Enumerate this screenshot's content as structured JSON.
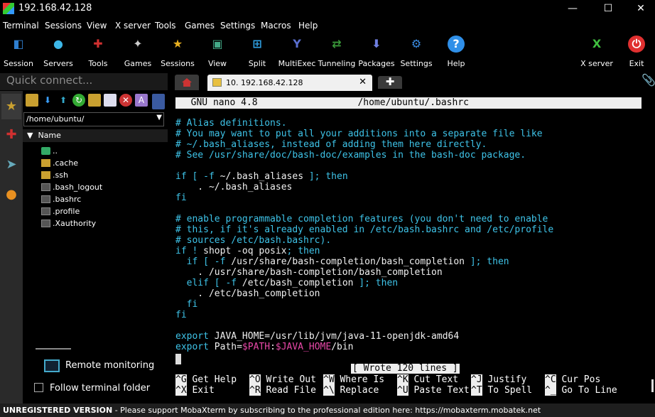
{
  "window": {
    "title": "192.168.42.128",
    "minimize": "—",
    "maximize": "☐",
    "close": "✕"
  },
  "menu": [
    "Terminal",
    "Sessions",
    "View",
    "X server",
    "Tools",
    "Games",
    "Settings",
    "Macros",
    "Help"
  ],
  "toolbar": [
    {
      "label": "Session",
      "icon": "session-icon",
      "glyph": "◧",
      "color": "#2f7fd0"
    },
    {
      "label": "Servers",
      "icon": "servers-icon",
      "glyph": "●",
      "color": "#3db7e8"
    },
    {
      "label": "Tools",
      "icon": "tools-icon",
      "glyph": "✚",
      "color": "#d03030"
    },
    {
      "label": "Games",
      "icon": "games-icon",
      "glyph": "✦",
      "color": "#cccccc"
    },
    {
      "label": "Sessions",
      "icon": "star-icon",
      "glyph": "★",
      "color": "#e8b020"
    },
    {
      "label": "View",
      "icon": "view-icon",
      "glyph": "▣",
      "color": "#4a8"
    },
    {
      "label": "Split",
      "icon": "split-icon",
      "glyph": "⊞",
      "color": "#2f9fe0"
    },
    {
      "label": "MultiExec",
      "icon": "multiexec-icon",
      "glyph": "Y",
      "color": "#5a6fd0"
    },
    {
      "label": "Tunneling",
      "icon": "tunneling-icon",
      "glyph": "⇄",
      "color": "#3a9a3a"
    },
    {
      "label": "Packages",
      "icon": "packages-icon",
      "glyph": "⬇",
      "color": "#6f7fe0"
    },
    {
      "label": "Settings",
      "icon": "settings-icon",
      "glyph": "⚙",
      "color": "#3a8ae0"
    },
    {
      "label": "Help",
      "icon": "help-icon",
      "glyph": "?",
      "color": "#2f8fe8"
    },
    {
      "label": "X server",
      "icon": "xserver-icon",
      "glyph": "X",
      "color": "#40c040"
    },
    {
      "label": "Exit",
      "icon": "exit-icon",
      "glyph": "⏻",
      "color": "#e03030"
    }
  ],
  "quick_connect": {
    "placeholder": "Quick connect..."
  },
  "tabs": {
    "session_label": "10. 192.168.42.128",
    "close": "✕",
    "add": "✚"
  },
  "files": {
    "path": "/home/ubuntu/",
    "column": "Name",
    "items": [
      {
        "name": "..",
        "type": "up"
      },
      {
        "name": ".cache",
        "type": "folder"
      },
      {
        "name": ".ssh",
        "type": "folder"
      },
      {
        "name": ".bash_logout",
        "type": "file"
      },
      {
        "name": ".bashrc",
        "type": "file"
      },
      {
        "name": ".profile",
        "type": "file"
      },
      {
        "name": ".Xauthority",
        "type": "file"
      }
    ],
    "remote_monitoring": "Remote monitoring",
    "follow_folder": "Follow terminal folder"
  },
  "nano": {
    "header": "  GNU nano 4.8                  /home/ubuntu/.bashrc",
    "status": "[ Wrote 120 lines ]",
    "shortcuts_row1": [
      {
        "key": "^G",
        "label": " Get Help  "
      },
      {
        "key": "^O",
        "label": " Write Out "
      },
      {
        "key": "^W",
        "label": " Where Is  "
      },
      {
        "key": "^K",
        "label": " Cut Text  "
      },
      {
        "key": "^J",
        "label": " Justify   "
      },
      {
        "key": "^C",
        "label": " Cur Pos"
      }
    ],
    "shortcuts_row2": [
      {
        "key": "^X",
        "label": " Exit      "
      },
      {
        "key": "^R",
        "label": " Read File "
      },
      {
        "key": "^\\",
        "label": " Replace   "
      },
      {
        "key": "^U",
        "label": " Paste Text"
      },
      {
        "key": "^T",
        "label": " To Spell  "
      },
      {
        "key": "^_",
        "label": " Go To Line"
      }
    ]
  },
  "bashrc": {
    "l1": "# Alias definitions.",
    "l2": "# You may want to put all your additions into a separate file like",
    "l3": "# ~/.bash_aliases, instead of adding them here directly.",
    "l4": "# See /usr/share/doc/bash-doc/examples in the bash-doc package.",
    "l6a": "if [ ",
    "l6b": "-f",
    "l6c": " ~/.bash_aliases",
    "l6d": " ]; then",
    "l7": "    . ~/.bash_aliases",
    "l8": "fi",
    "l10": "# enable programmable completion features (you don't need to enable",
    "l11": "# this, if it's already enabled in /etc/bash.bashrc and /etc/profile",
    "l12": "# sources /etc/bash.bashrc).",
    "l13a": "if ! ",
    "l13b": "shopt -oq posix",
    "l13c": "; then",
    "l14a": "  if [ ",
    "l14b": "-f",
    "l14c": " /usr/share/bash-completion/bash_completion",
    "l14d": " ]; then",
    "l15": "    . /usr/share/bash-completion/bash_completion",
    "l16a": "  elif [ ",
    "l16b": "-f",
    "l16c": " /etc/bash_completion",
    "l16d": " ]; then",
    "l17": "    . /etc/bash_completion",
    "l18": "  fi",
    "l19": "fi",
    "l21a": "export ",
    "l21b": "JAVA_HOME",
    "l21c": "=/usr/lib/jvm/java-11-openjdk-amd64",
    "l22a": "export ",
    "l22b": "Path",
    "l22c": "=",
    "l22d": "$PATH",
    "l22e": ":",
    "l22f": "$JAVA_HOME",
    "l22g": "/bin"
  },
  "footer": {
    "bold": "UNREGISTERED VERSION",
    "text": "  -  Please support MobaXterm by subscribing to the professional edition here:  https://mobaxterm.mobatek.net"
  }
}
